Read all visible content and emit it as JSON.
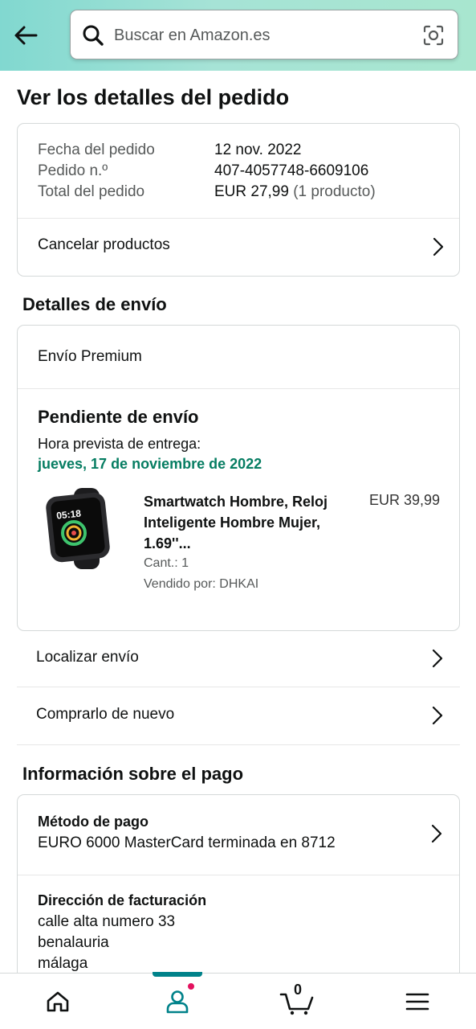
{
  "search": {
    "placeholder": "Buscar en Amazon.es"
  },
  "page": {
    "title": "Ver los detalles del pedido"
  },
  "summary": {
    "date_label": "Fecha del pedido",
    "date_value": "12 nov. 2022",
    "order_label": "Pedido n.º",
    "order_value": "407-4057748-6609106",
    "total_label": "Total del pedido",
    "total_value": "EUR 27,99",
    "total_count": "(1 producto)",
    "cancel_label": "Cancelar productos"
  },
  "shipping": {
    "section_title": "Detalles de envío",
    "type": "Envío Premium",
    "status": "Pendiente de envío",
    "eta_label": "Hora prevista de entrega:",
    "eta_date": "jueves, 17 de noviembre de 2022",
    "product": {
      "name": "Smartwatch Hombre, Reloj Inteligente Hombre Mujer, 1.69''...",
      "price": "EUR 39,99",
      "qty": "Cant.: 1",
      "seller": "Vendido por: DHKAI",
      "watch_time": "05:18"
    },
    "track_label": "Localizar envío",
    "buy_again_label": "Comprarlo de nuevo"
  },
  "payment": {
    "section_title": "Información sobre el pago",
    "method_title": "Método de pago",
    "method_value": "EURO 6000 MasterCard terminada en 8712",
    "billing_title": "Dirección de facturación",
    "billing_line1": "calle alta numero 33",
    "billing_line2": "benalauria",
    "billing_line3": "málaga"
  },
  "nav": {
    "cart_count": "0",
    "active": "account",
    "accent_color": "#00828a",
    "badge_color": "#e3115e"
  },
  "icons": [
    "back-arrow-icon",
    "search-icon",
    "camera-icon",
    "chevron-right-icon",
    "home-icon",
    "account-icon",
    "cart-icon",
    "menu-icon"
  ]
}
